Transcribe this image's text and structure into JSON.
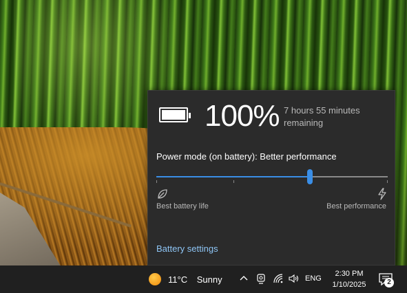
{
  "flyout": {
    "battery_percent": "100%",
    "time_remaining": "7 hours 55 minutes remaining",
    "power_mode_label": "Power mode (on battery): Better performance",
    "slider": {
      "value_fraction": 0.665,
      "ticks": 4
    },
    "left_label": "Best battery life",
    "right_label": "Best performance",
    "settings_link": "Battery settings",
    "colors": {
      "background": "#2b2b2b",
      "accent": "#3a8ee6",
      "link": "#8ec5f5"
    }
  },
  "taskbar": {
    "weather": {
      "temperature": "11°C",
      "condition": "Sunny",
      "icon": "sun-icon"
    },
    "tray_icons": [
      "chevron-up-icon",
      "meet-now-icon",
      "wifi-icon",
      "volume-icon"
    ],
    "language": "ENG",
    "time": "2:30 PM",
    "date": "1/10/2025",
    "notification_count": "2"
  }
}
